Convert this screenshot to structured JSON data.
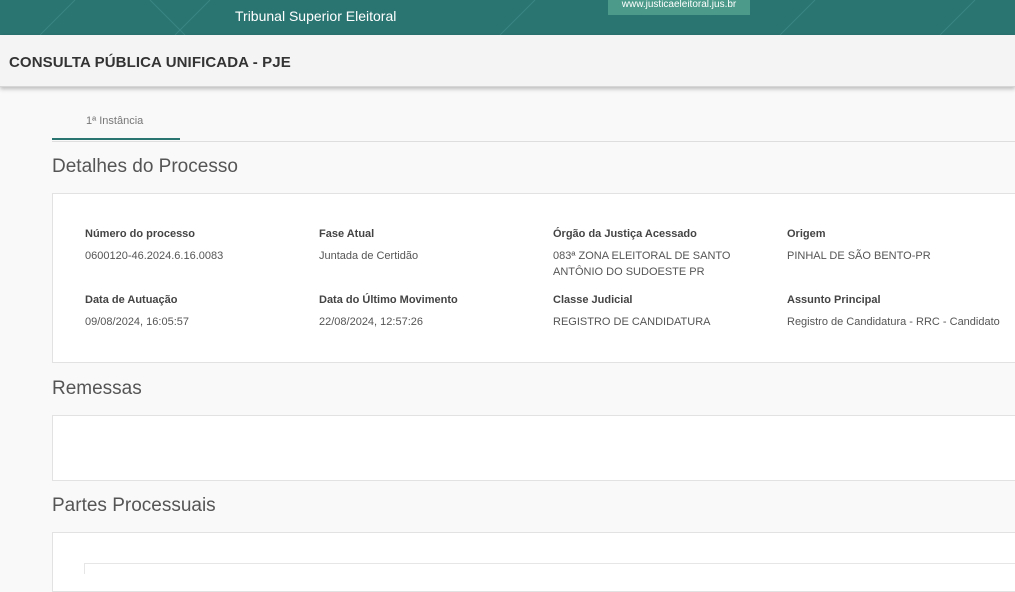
{
  "banner": {
    "title": "Tribunal Superior Eleitoral",
    "link": "www.justicaeleitoral.jus.br",
    "color": "#2a7472"
  },
  "header": {
    "title": "CONSULTA PÚBLICA UNIFICADA - PJE"
  },
  "tabs": [
    {
      "label": "1ª Instância",
      "active": true
    }
  ],
  "sections": {
    "details": "Detalhes do Processo",
    "remessas": "Remessas",
    "partes": "Partes Processuais"
  },
  "details": {
    "numero": {
      "label": "Número do processo",
      "value": "0600120-46.2024.6.16.0083"
    },
    "fase": {
      "label": "Fase Atual",
      "value": "Juntada de Certidão"
    },
    "orgao": {
      "label": "Órgão da Justiça Acessado",
      "value": "083ª ZONA ELEITORAL DE SANTO ANTÔNIO DO SUDOESTE PR"
    },
    "origem": {
      "label": "Origem",
      "value": "PINHAL DE SÃO BENTO-PR"
    },
    "autuacao": {
      "label": "Data de Autuação",
      "value": "09/08/2024, 16:05:57"
    },
    "ultimo_mov": {
      "label": "Data do Último Movimento",
      "value": "22/08/2024, 12:57:26"
    },
    "classe": {
      "label": "Classe Judicial",
      "value": "REGISTRO DE CANDIDATURA"
    },
    "assunto": {
      "label": "Assunto Principal",
      "value": "Registro de Candidatura - RRC - Candidato"
    }
  }
}
